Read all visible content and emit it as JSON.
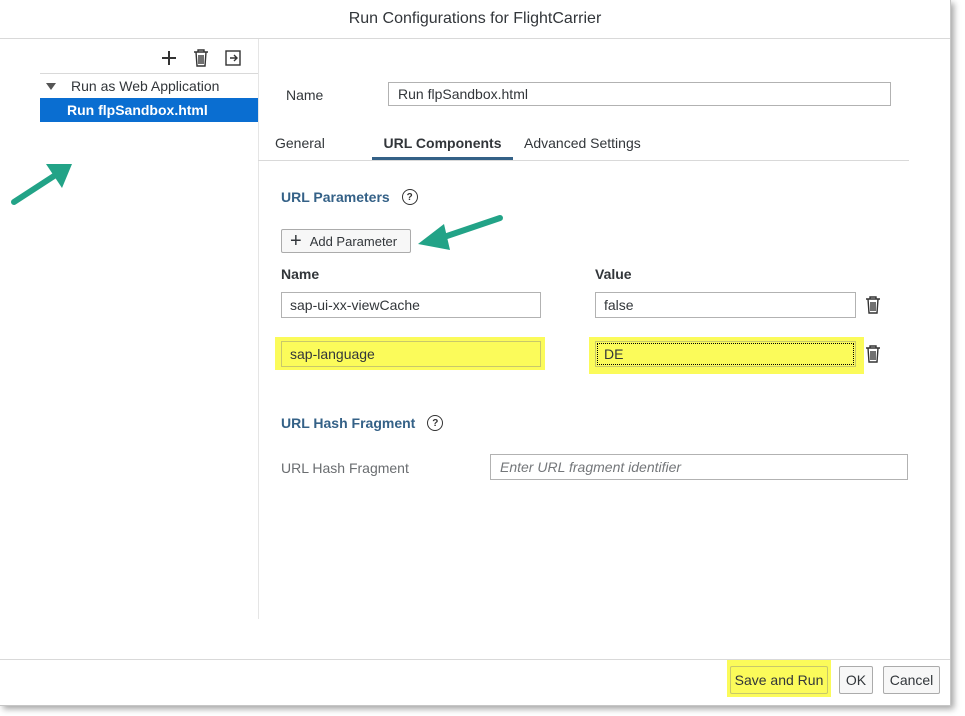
{
  "dialog": {
    "title": "Run Configurations for FlightCarrier"
  },
  "toolbar": {
    "icons": [
      "add-icon",
      "delete-icon",
      "duplicate-icon"
    ]
  },
  "tree": {
    "group_label": "Run as Web Application",
    "selected_item": "Run flpSandbox.html"
  },
  "config": {
    "name_label": "Name",
    "name_value": "Run flpSandbox.html"
  },
  "tabs": [
    {
      "label": "General"
    },
    {
      "label": "URL Components",
      "active": true
    },
    {
      "label": "Advanced Settings"
    }
  ],
  "url_params": {
    "title": "URL Parameters",
    "add_button": "Add Parameter",
    "name_header": "Name",
    "value_header": "Value",
    "rows": [
      {
        "name": "sap-ui-xx-viewCache",
        "value": "false"
      },
      {
        "name": "sap-language",
        "value": "DE"
      }
    ]
  },
  "hash": {
    "title": "URL Hash Fragment",
    "label": "URL Hash Fragment",
    "placeholder": "Enter URL fragment identifier"
  },
  "footer": {
    "save_run": "Save and Run",
    "ok": "OK",
    "cancel": "Cancel"
  },
  "colors": {
    "highlight": "#fbfb5a",
    "selection": "#0a6ed1",
    "section_title": "#346187",
    "arrow": "#22a387"
  }
}
